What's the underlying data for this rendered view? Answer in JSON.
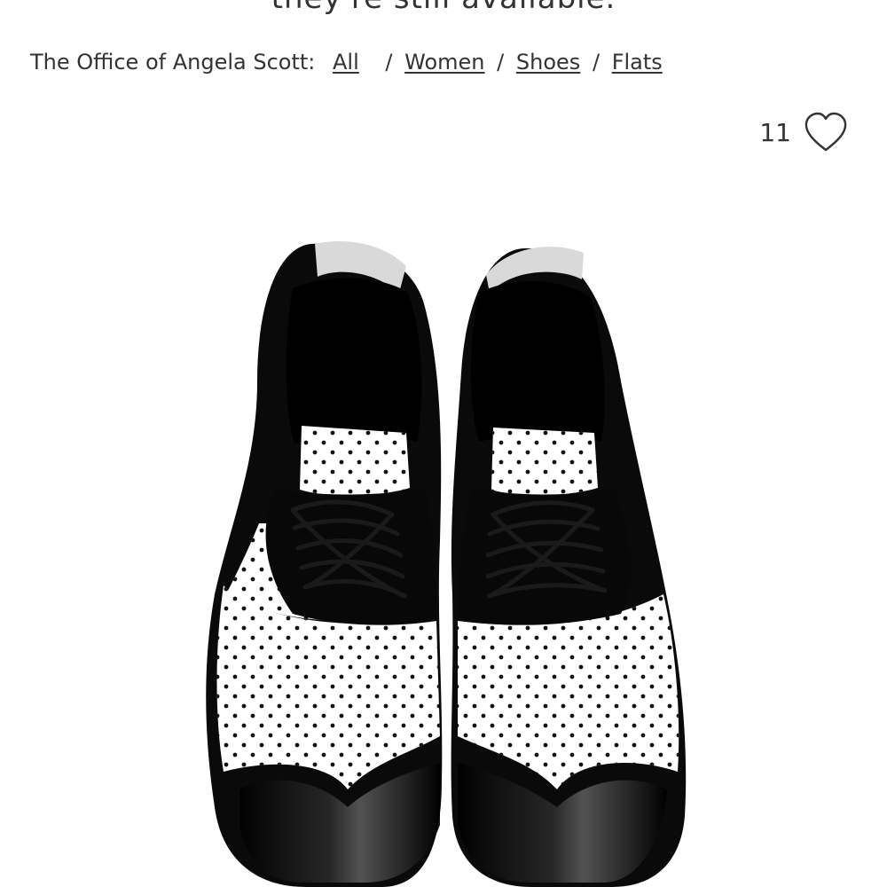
{
  "banner": {
    "text": "they're still available."
  },
  "breadcrumb": {
    "store": "The Office of Angela Scott:",
    "items": [
      "All",
      "Women",
      "Shoes",
      "Flats"
    ],
    "separator": "/"
  },
  "favorite": {
    "count": "11",
    "icon": "heart-outline-icon"
  },
  "product": {
    "image": "black-white-patent-perforated-oxford-shoes",
    "colors": {
      "black": "#0b0b0b",
      "white": "#ffffff"
    }
  }
}
